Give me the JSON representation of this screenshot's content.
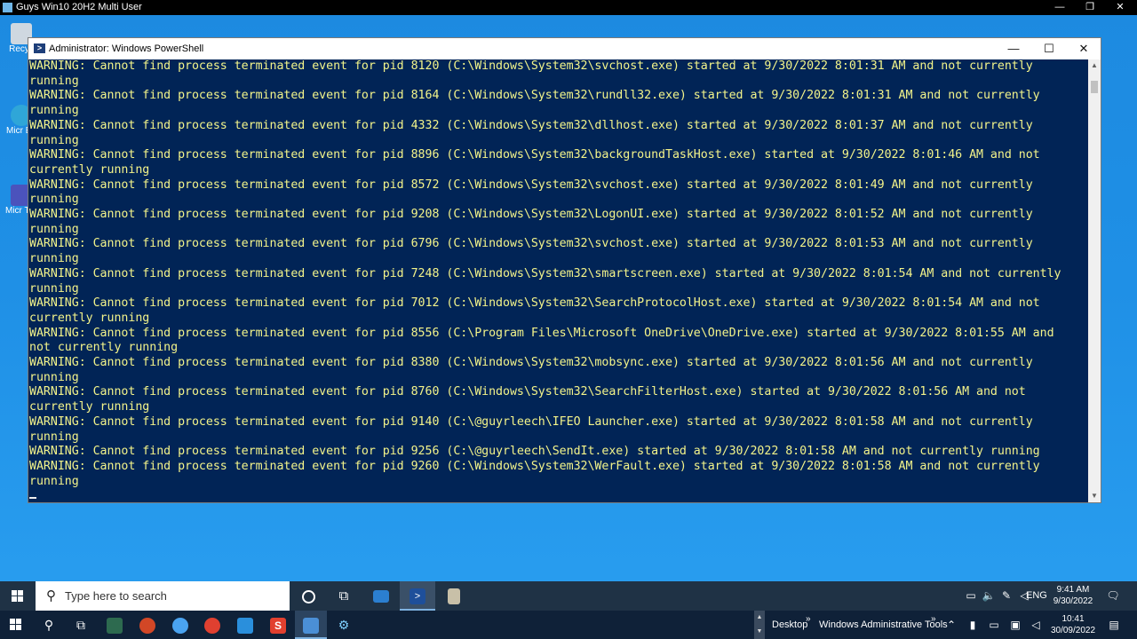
{
  "host": {
    "title": "Guys Win10 20H2 Multi User",
    "minimize_glyph": "—",
    "restore_glyph": "❐",
    "close_glyph": "✕"
  },
  "desktop_icons": [
    {
      "label": "Recyc",
      "icon": "recycle-bin-icon"
    },
    {
      "label": "Micr Ed",
      "icon": "edge-icon"
    },
    {
      "label": "Micr Tea",
      "icon": "teams-icon"
    }
  ],
  "window": {
    "title": "Administrator: Windows PowerShell",
    "minimize_glyph": "—",
    "maximize_glyph": "☐",
    "close_glyph": "✕"
  },
  "console_lines": [
    "WARNING: Cannot find process terminated event for pid 8120 (C:\\Windows\\System32\\svchost.exe) started at 9/30/2022 8:01:31 AM and not currently",
    "running",
    "WARNING: Cannot find process terminated event for pid 8164 (C:\\Windows\\System32\\rundll32.exe) started at 9/30/2022 8:01:31 AM and not currently",
    "running",
    "WARNING: Cannot find process terminated event for pid 4332 (C:\\Windows\\System32\\dllhost.exe) started at 9/30/2022 8:01:37 AM and not currently",
    "running",
    "WARNING: Cannot find process terminated event for pid 8896 (C:\\Windows\\System32\\backgroundTaskHost.exe) started at 9/30/2022 8:01:46 AM and not",
    "currently running",
    "WARNING: Cannot find process terminated event for pid 8572 (C:\\Windows\\System32\\svchost.exe) started at 9/30/2022 8:01:49 AM and not currently",
    "running",
    "WARNING: Cannot find process terminated event for pid 9208 (C:\\Windows\\System32\\LogonUI.exe) started at 9/30/2022 8:01:52 AM and not currently",
    "running",
    "WARNING: Cannot find process terminated event for pid 6796 (C:\\Windows\\System32\\svchost.exe) started at 9/30/2022 8:01:53 AM and not currently",
    "running",
    "WARNING: Cannot find process terminated event for pid 7248 (C:\\Windows\\System32\\smartscreen.exe) started at 9/30/2022 8:01:54 AM and not currently",
    "running",
    "WARNING: Cannot find process terminated event for pid 7012 (C:\\Windows\\System32\\SearchProtocolHost.exe) started at 9/30/2022 8:01:54 AM and not",
    "currently running",
    "WARNING: Cannot find process terminated event for pid 8556 (C:\\Program Files\\Microsoft OneDrive\\OneDrive.exe) started at 9/30/2022 8:01:55 AM and",
    "not currently running",
    "WARNING: Cannot find process terminated event for pid 8380 (C:\\Windows\\System32\\mobsync.exe) started at 9/30/2022 8:01:56 AM and not currently",
    "running",
    "WARNING: Cannot find process terminated event for pid 8760 (C:\\Windows\\System32\\SearchFilterHost.exe) started at 9/30/2022 8:01:56 AM and not",
    "currently running",
    "WARNING: Cannot find process terminated event for pid 9140 (C:\\@guyrleech\\IFEO Launcher.exe) started at 9/30/2022 8:01:58 AM and not currently",
    "running",
    "WARNING: Cannot find process terminated event for pid 9256 (C:\\@guyrleech\\SendIt.exe) started at 9/30/2022 8:01:58 AM and not currently running",
    "WARNING: Cannot find process terminated event for pid 9260 (C:\\Windows\\System32\\WerFault.exe) started at 9/30/2022 8:01:58 AM and not currently",
    "running"
  ],
  "vm_taskbar": {
    "search_placeholder": "Type here to search",
    "language": "ENG",
    "time": "9:41 AM",
    "date": "9/30/2022"
  },
  "host_taskbar": {
    "toolbar_desktop": "Desktop",
    "toolbar_admin_tools": "Windows Administrative Tools",
    "chevron": "»",
    "time": "10:41",
    "date": "30/09/2022"
  },
  "colors": {
    "console_bg": "#012456",
    "console_text": "#f3f38a",
    "desktop": "#1f90e6"
  }
}
